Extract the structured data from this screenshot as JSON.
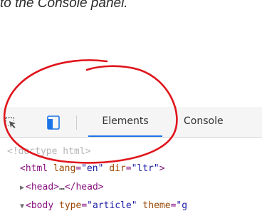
{
  "caption": {
    "text": "to the Console panel."
  },
  "toolbar": {
    "icons": [
      "inspect-element-icon",
      "device-emulation-icon"
    ],
    "tabs": [
      {
        "label": "Elements",
        "active": true
      },
      {
        "label": "Console",
        "active": false
      }
    ]
  },
  "dom_tree": {
    "doctype": "<!doctype html>",
    "html_line": {
      "open": "<html",
      "attr1_name": "lang",
      "attr1_value": "\"en\"",
      "attr2_name": "dir",
      "attr2_value": "\"ltr\"",
      "close": ">"
    },
    "head_line": {
      "open": "<head>",
      "ellipsis": "…",
      "close": "</head>"
    },
    "body_line": {
      "open": "<body",
      "attr1_name": "type",
      "attr1_value": "\"article\"",
      "attr2_name": "theme",
      "attr2_value": "\"g"
    }
  },
  "colors": {
    "accent_tab_underline": "#1a73e8",
    "annotation_circle": "#e0141b",
    "icon_blue": "#1a73e8"
  }
}
